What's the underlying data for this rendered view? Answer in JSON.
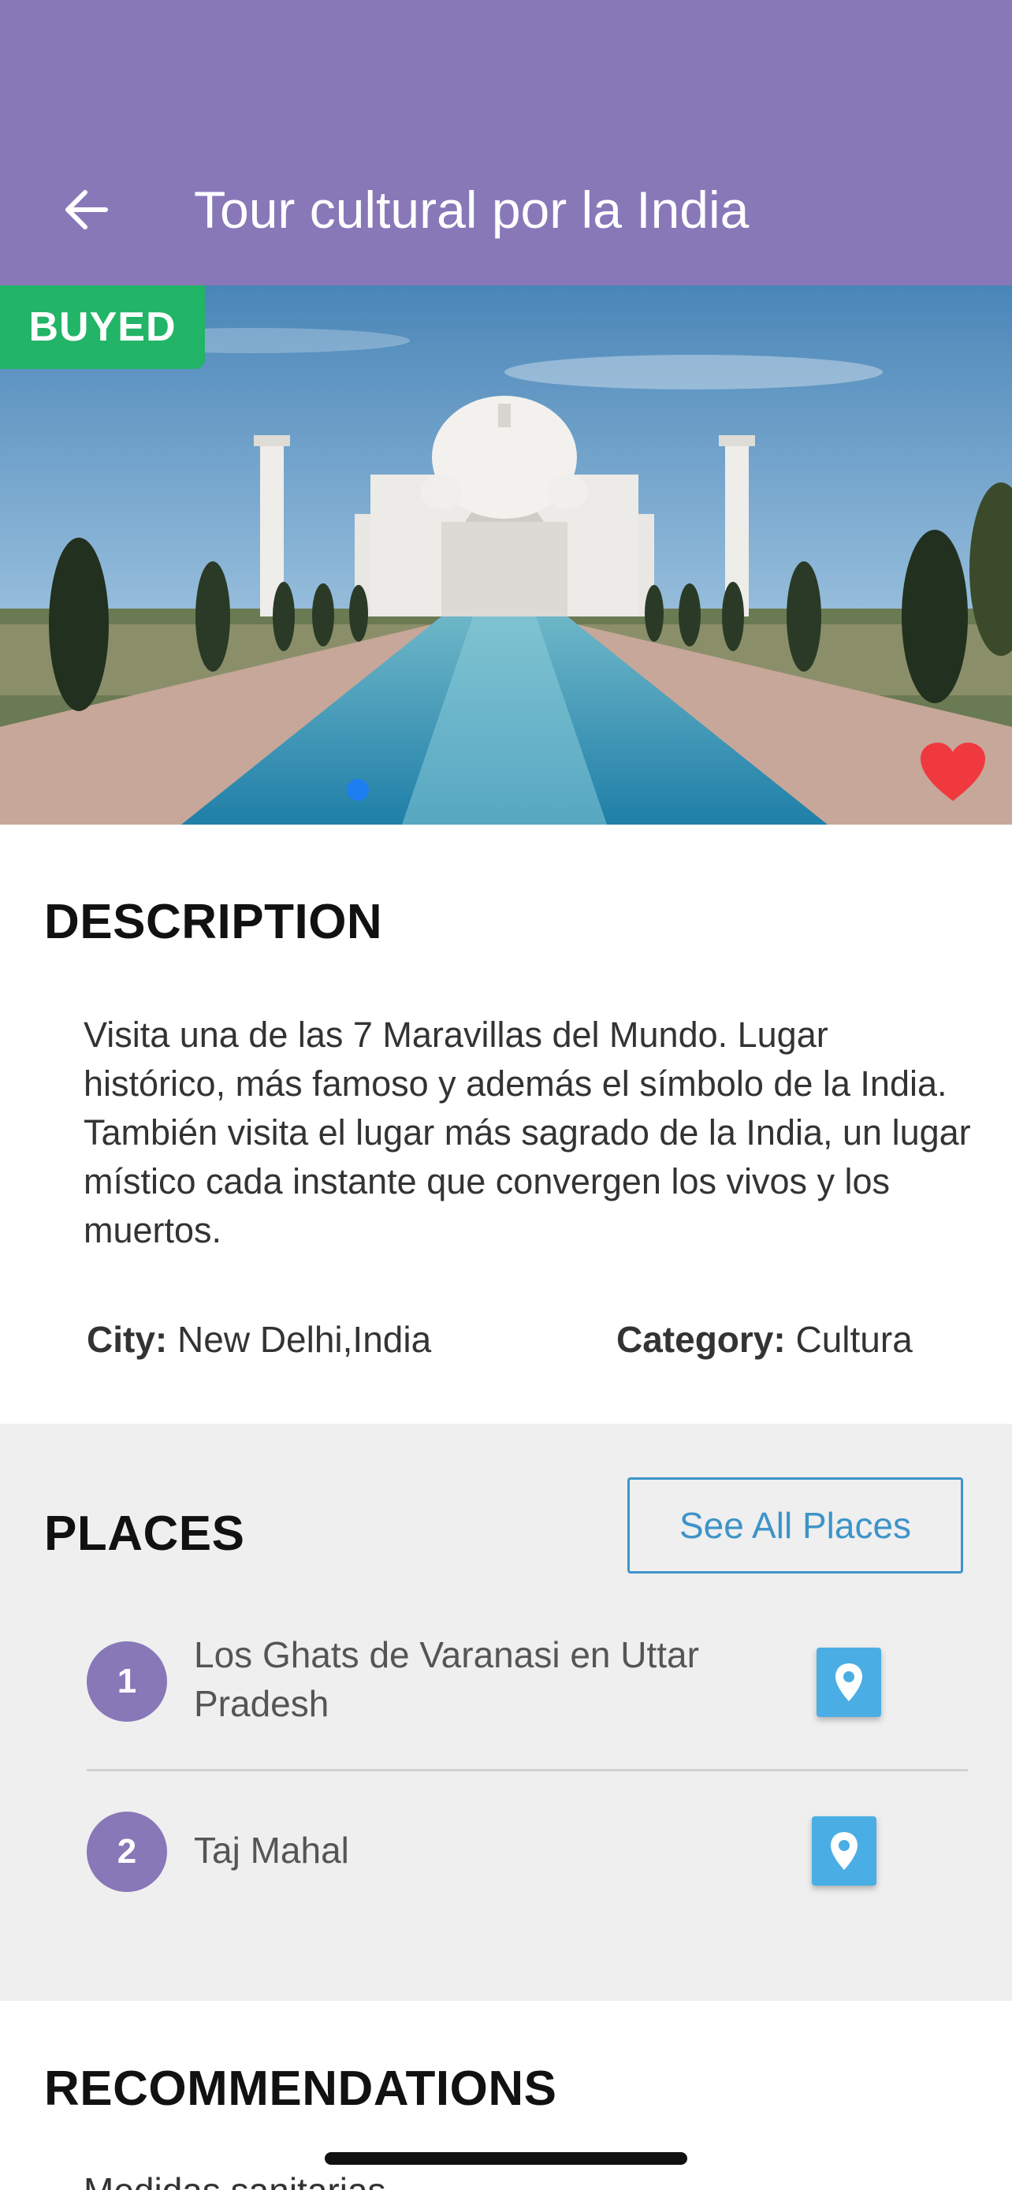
{
  "appbar": {
    "title": "Tour cultural por la India",
    "back_icon": "arrow-left-icon",
    "color": "#8878b8"
  },
  "hero": {
    "badge": "BUYED",
    "badge_color": "#22b467",
    "favorite_icon": "heart-icon",
    "favorite_color": "#f0393e",
    "carousel_dots": 2,
    "active_dot": 0
  },
  "description": {
    "title": "DESCRIPTION",
    "text": "Visita una de las 7 Maravillas del Mundo. Lugar histórico, más famoso y además el símbolo de la India. También visita el lugar más sagrado de la India, un lugar místico cada instante que convergen los vivos y los muertos.",
    "city_label": "City:",
    "city_value": "New Delhi,India",
    "category_label": "Category:",
    "category_value": "Cultura"
  },
  "places": {
    "title": "PLACES",
    "see_all_label": "See All Places",
    "items": [
      {
        "number": "1",
        "name": "Los Ghats de Varanasi en Uttar Pradesh",
        "icon": "map-pin-icon"
      },
      {
        "number": "2",
        "name": "Taj Mahal",
        "icon": "map-pin-icon"
      }
    ]
  },
  "recommendations": {
    "title": "RECOMMENDATIONS",
    "peek_text": "Medidas sanitarias"
  }
}
